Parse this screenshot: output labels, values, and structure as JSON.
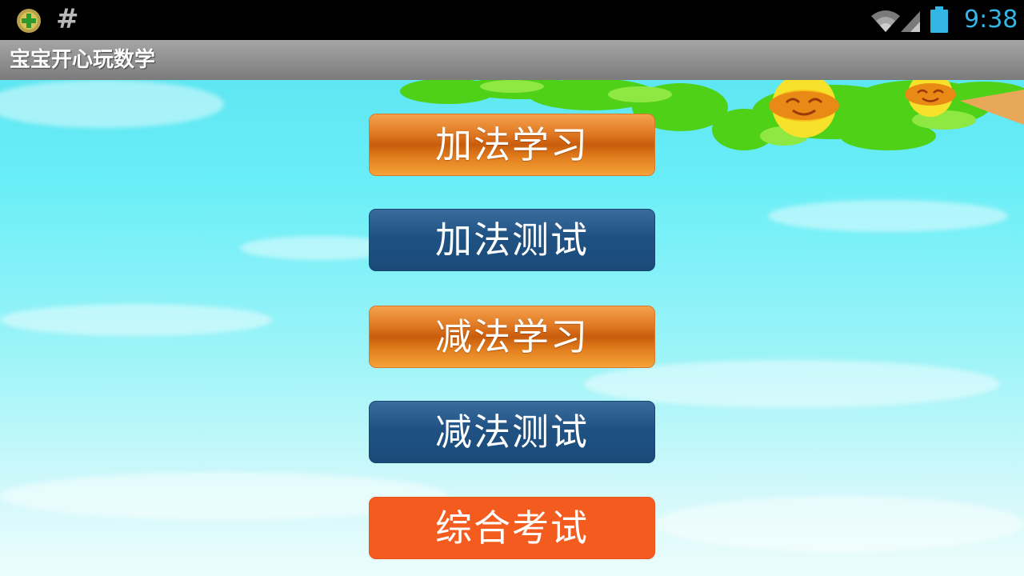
{
  "status_bar": {
    "time": "9:38",
    "app_icon": "plus-circle-icon",
    "notification_icon": "hash-icon",
    "hash_symbol": "#",
    "wifi_icon": "wifi-icon",
    "signal_icon": "signal-icon",
    "battery_icon": "battery-icon",
    "time_color": "#33b5e5"
  },
  "app_bar": {
    "title": "宝宝开心玩数学"
  },
  "menu": {
    "items": [
      {
        "label": "加法学习",
        "style": "orange"
      },
      {
        "label": "加法测试",
        "style": "blue"
      },
      {
        "label": "减法学习",
        "style": "orange"
      },
      {
        "label": "减法测试",
        "style": "blue"
      },
      {
        "label": "综合考试",
        "style": "red"
      }
    ]
  },
  "colors": {
    "orange": "#e27b26",
    "blue": "#1f5283",
    "red": "#f45b1e",
    "sky": "#69eef7"
  }
}
